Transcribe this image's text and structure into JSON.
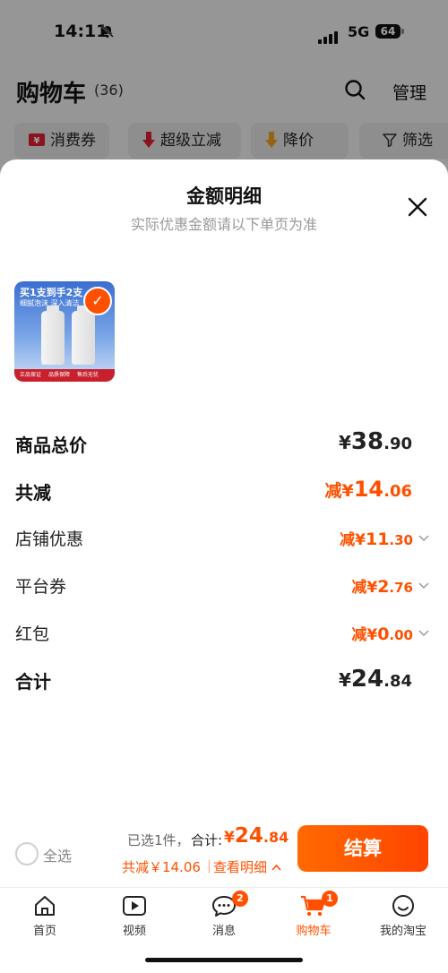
{
  "status_bar": {
    "time": "14:11",
    "network": "5G",
    "battery": "64"
  },
  "cart": {
    "title": "购物车",
    "count": "(36)",
    "manage_label": "管理",
    "chips": [
      {
        "label": "消费券",
        "icon": "coupon-icon"
      },
      {
        "label": "超级立减",
        "icon": "arrow-down-icon"
      },
      {
        "label": "降价",
        "icon": "price-drop-icon"
      },
      {
        "label": "筛选",
        "icon": "filter-icon"
      }
    ]
  },
  "sheet": {
    "title": "金额明细",
    "subtitle": "实际优惠金额请以下单页为准",
    "product": {
      "promo_line1": "买1支到手2支",
      "promo_line2": "细腻泡沫 深入清洁",
      "tube_brand": "BELLE",
      "badges": [
        "正品保证",
        "品质保障",
        "售后无忧"
      ]
    },
    "rows": {
      "total": {
        "label": "商品总价",
        "currency": "¥",
        "int": "38",
        "dec": ".90"
      },
      "reduce": {
        "label": "共减",
        "currency": "减¥",
        "int": "14",
        "dec": ".06"
      },
      "store": {
        "label": "店铺优惠",
        "currency": "减¥",
        "int": "11",
        "dec": ".30"
      },
      "platform": {
        "label": "平台券",
        "currency": "减¥",
        "int": "2",
        "dec": ".76"
      },
      "redpacket": {
        "label": "红包",
        "currency": "减¥",
        "int": "0",
        "dec": ".00"
      },
      "sum": {
        "label": "合计",
        "currency": "¥",
        "int": "24",
        "dec": ".84"
      }
    }
  },
  "bottom": {
    "select_all": "全选",
    "selected": "已选1件，",
    "total_label": "合计:",
    "total_currency": "¥",
    "total_int": "24",
    "total_dec": ".84",
    "reduce_text": "共减￥14.06",
    "separator": "|",
    "detail_text": "查看明细",
    "checkout": "结算"
  },
  "tabbar": [
    {
      "label": "首页",
      "icon": "home-icon"
    },
    {
      "label": "视频",
      "icon": "video-icon"
    },
    {
      "label": "消息",
      "icon": "message-icon",
      "badge": "2"
    },
    {
      "label": "购物车",
      "icon": "cart-icon",
      "badge": "1"
    },
    {
      "label": "我的淘宝",
      "icon": "profile-icon"
    }
  ],
  "colors": {
    "accent": "#ff5000",
    "overlay": "rgba(0,0,0,0.38)"
  }
}
